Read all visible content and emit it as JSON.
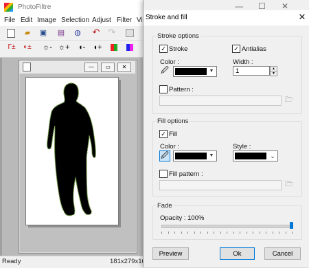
{
  "app": {
    "title": "PhotoFiltre",
    "menu": [
      "File",
      "Edit",
      "Image",
      "Selection",
      "Adjust",
      "Filter",
      "Vi"
    ],
    "status_ready": "Ready",
    "status_size": "181x279x16M"
  },
  "toolbar_icons": [
    "new-file-icon",
    "open-folder-icon",
    "save-icon",
    "print-icon",
    "scan-icon",
    "undo-icon",
    "redo-icon",
    "copy-icon"
  ],
  "dialog": {
    "title": "Stroke and fill",
    "stroke_options": {
      "group_title": "Stroke options",
      "stroke_label": "Stroke",
      "stroke_checked": true,
      "antialias_label": "Antialias",
      "antialias_checked": true,
      "color_label": "Color :",
      "color_value": "#000000",
      "width_label": "Width :",
      "width_value": "1",
      "pattern_label": "Pattern :",
      "pattern_checked": false
    },
    "fill_options": {
      "group_title": "Fill options",
      "fill_label": "Fill",
      "fill_checked": true,
      "color_label": "Color :",
      "color_value": "#000000",
      "style_label": "Style :",
      "style_value": "#000000",
      "fill_pattern_label": "Fill pattern :",
      "fill_pattern_checked": false
    },
    "fade": {
      "group_title": "Fade",
      "opacity_label": "Opacity : 100%",
      "opacity_value": 100
    },
    "buttons": {
      "preview": "Preview",
      "ok": "Ok",
      "cancel": "Cancel"
    }
  },
  "colors": {
    "accent": "#0078d7",
    "silhouette": "#000000",
    "outline": "#6a9a3a"
  }
}
